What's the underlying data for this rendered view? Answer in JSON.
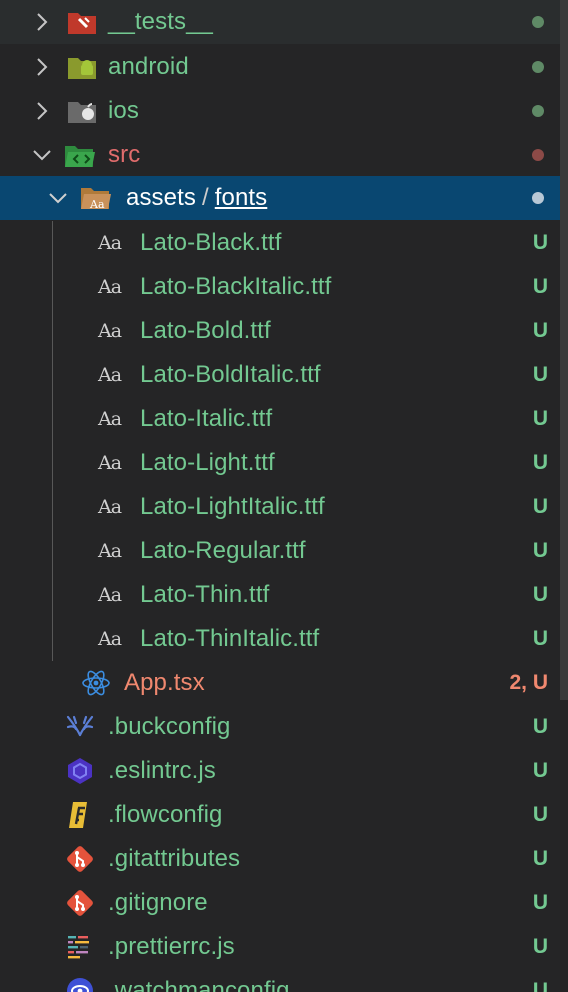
{
  "explorer": {
    "folders": [
      {
        "name": "__tests__",
        "icon": "tests-folder-icon",
        "status": "dot"
      },
      {
        "name": "android",
        "icon": "android-folder-icon",
        "status": "dot"
      },
      {
        "name": "ios",
        "icon": "ios-folder-icon",
        "status": "dot"
      },
      {
        "name": "src",
        "icon": "src-folder-icon",
        "status": "dot"
      }
    ],
    "selected_path": {
      "part1": "assets",
      "separator": "/",
      "part2": "fonts"
    },
    "font_files": [
      {
        "icon_text": "Aa",
        "name": "Lato-Black.ttf",
        "status": "U"
      },
      {
        "icon_text": "Aa",
        "name": "Lato-BlackItalic.ttf",
        "status": "U"
      },
      {
        "icon_text": "Aa",
        "name": "Lato-Bold.ttf",
        "status": "U"
      },
      {
        "icon_text": "Aa",
        "name": "Lato-BoldItalic.ttf",
        "status": "U"
      },
      {
        "icon_text": "Aa",
        "name": "Lato-Italic.ttf",
        "status": "U"
      },
      {
        "icon_text": "Aa",
        "name": "Lato-Light.ttf",
        "status": "U"
      },
      {
        "icon_text": "Aa",
        "name": "Lato-LightItalic.ttf",
        "status": "U"
      },
      {
        "icon_text": "Aa",
        "name": "Lato-Regular.ttf",
        "status": "U"
      },
      {
        "icon_text": "Aa",
        "name": "Lato-Thin.ttf",
        "status": "U"
      },
      {
        "icon_text": "Aa",
        "name": "Lato-ThinItalic.ttf",
        "status": "U"
      }
    ],
    "app_file": {
      "name": "App.tsx",
      "status": "2, U",
      "icon": "react-icon"
    },
    "root_files": [
      {
        "name": ".buckconfig",
        "status": "U",
        "icon": "buck-icon"
      },
      {
        "name": ".eslintrc.js",
        "status": "U",
        "icon": "eslint-icon"
      },
      {
        "name": ".flowconfig",
        "status": "U",
        "icon": "flow-icon"
      },
      {
        "name": ".gitattributes",
        "status": "U",
        "icon": "git-icon"
      },
      {
        "name": ".gitignore",
        "status": "U",
        "icon": "git-icon"
      },
      {
        "name": ".prettierrc.js",
        "status": "U",
        "icon": "prettier-icon"
      },
      {
        "name": ".watchmanconfig",
        "status": "U",
        "icon": "watchman-icon"
      }
    ]
  },
  "colors": {
    "background": "#252526",
    "selection": "#094771",
    "untracked_green": "#73c991",
    "error_red": "#e06c6c"
  }
}
